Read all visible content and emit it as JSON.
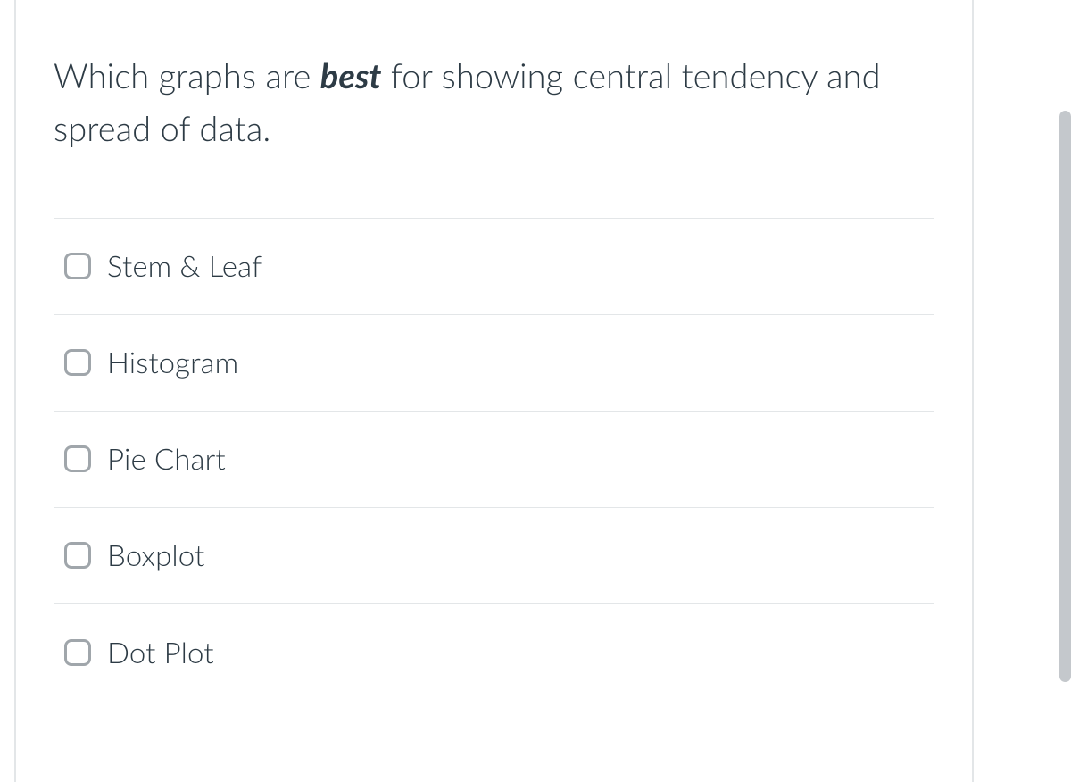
{
  "question": {
    "prefix": "Which graphs are ",
    "emphasis": "best",
    "suffix": " for showing central tendency and spread of data."
  },
  "options": [
    {
      "label": "Stem & Leaf",
      "checked": false
    },
    {
      "label": "Histogram",
      "checked": false
    },
    {
      "label": "Pie Chart",
      "checked": false
    },
    {
      "label": "Boxplot",
      "checked": false
    },
    {
      "label": "Dot Plot",
      "checked": false
    }
  ]
}
